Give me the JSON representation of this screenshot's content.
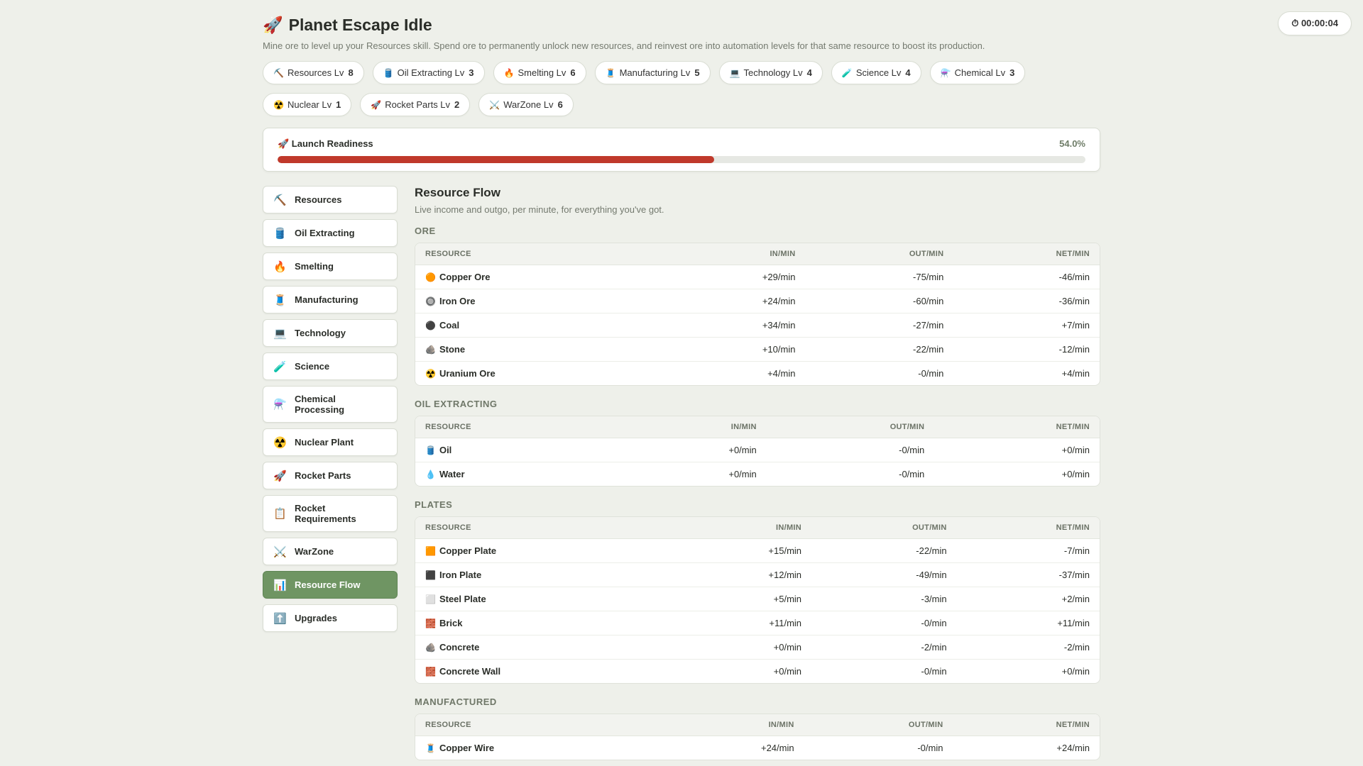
{
  "app": {
    "title": "Planet Escape Idle",
    "title_icon": "🚀",
    "subtitle": "Mine ore to level up your Resources skill. Spend ore to permanently unlock new resources, and reinvest ore into automation levels for that same resource to boost its production.",
    "timer": "⏱ 00:00:04"
  },
  "skills": [
    {
      "icon": "⛏️",
      "label": "Resources Lv",
      "level": "8"
    },
    {
      "icon": "🛢️",
      "label": "Oil Extracting Lv",
      "level": "3"
    },
    {
      "icon": "🔥",
      "label": "Smelting Lv",
      "level": "6"
    },
    {
      "icon": "🧵",
      "label": "Manufacturing Lv",
      "level": "5"
    },
    {
      "icon": "💻",
      "label": "Technology Lv",
      "level": "4"
    },
    {
      "icon": "🧪",
      "label": "Science Lv",
      "level": "4"
    },
    {
      "icon": "⚗️",
      "label": "Chemical Lv",
      "level": "3"
    },
    {
      "icon": "☢️",
      "label": "Nuclear Lv",
      "level": "1"
    },
    {
      "icon": "🚀",
      "label": "Rocket Parts Lv",
      "level": "2"
    },
    {
      "icon": "⚔️",
      "label": "WarZone Lv",
      "level": "6"
    }
  ],
  "readiness": {
    "label": "🚀 Launch Readiness",
    "percent_text": "54.0%",
    "fraction": 0.54,
    "bar_color": "#c0392b"
  },
  "nav": [
    {
      "icon": "⛏️",
      "label": "Resources",
      "active": false
    },
    {
      "icon": "🛢️",
      "label": "Oil Extracting",
      "active": false
    },
    {
      "icon": "🔥",
      "label": "Smelting",
      "active": false
    },
    {
      "icon": "🧵",
      "label": "Manufacturing",
      "active": false
    },
    {
      "icon": "💻",
      "label": "Technology",
      "active": false
    },
    {
      "icon": "🧪",
      "label": "Science",
      "active": false
    },
    {
      "icon": "⚗️",
      "label": "Chemical Processing",
      "active": false
    },
    {
      "icon": "☢️",
      "label": "Nuclear Plant",
      "active": false
    },
    {
      "icon": "🚀",
      "label": "Rocket Parts",
      "active": false
    },
    {
      "icon": "📋",
      "label": "Rocket Requirements",
      "active": false
    },
    {
      "icon": "⚔️",
      "label": "WarZone",
      "active": false
    },
    {
      "icon": "📊",
      "label": "Resource Flow",
      "active": true
    },
    {
      "icon": "⬆️",
      "label": "Upgrades",
      "active": false
    }
  ],
  "main": {
    "title": "Resource Flow",
    "description": "Live income and outgo, per minute, for everything you've got.",
    "columns": [
      "RESOURCE",
      "IN/MIN",
      "OUT/MIN",
      "NET/MIN"
    ],
    "sections": [
      {
        "name": "ORE",
        "rows": [
          {
            "icon": "🟠",
            "name": "Copper Ore",
            "in": "+29/min",
            "out": "-75/min",
            "net": "-46/min",
            "sign": "neg"
          },
          {
            "icon": "🔘",
            "name": "Iron Ore",
            "in": "+24/min",
            "out": "-60/min",
            "net": "-36/min",
            "sign": "neg"
          },
          {
            "icon": "⚫",
            "name": "Coal",
            "in": "+34/min",
            "out": "-27/min",
            "net": "+7/min",
            "sign": "pos"
          },
          {
            "icon": "🪨",
            "name": "Stone",
            "in": "+10/min",
            "out": "-22/min",
            "net": "-12/min",
            "sign": "neg"
          },
          {
            "icon": "☢️",
            "name": "Uranium Ore",
            "in": "+4/min",
            "out": "-0/min",
            "net": "+4/min",
            "sign": "pos"
          }
        ]
      },
      {
        "name": "OIL EXTRACTING",
        "rows": [
          {
            "icon": "🛢️",
            "name": "Oil",
            "in": "+0/min",
            "out": "-0/min",
            "net": "+0/min",
            "sign": "zero"
          },
          {
            "icon": "💧",
            "name": "Water",
            "in": "+0/min",
            "out": "-0/min",
            "net": "+0/min",
            "sign": "zero"
          }
        ]
      },
      {
        "name": "PLATES",
        "rows": [
          {
            "icon": "🟧",
            "name": "Copper Plate",
            "in": "+15/min",
            "out": "-22/min",
            "net": "-7/min",
            "sign": "neg"
          },
          {
            "icon": "⬛",
            "name": "Iron Plate",
            "in": "+12/min",
            "out": "-49/min",
            "net": "-37/min",
            "sign": "neg"
          },
          {
            "icon": "⬜",
            "name": "Steel Plate",
            "in": "+5/min",
            "out": "-3/min",
            "net": "+2/min",
            "sign": "pos"
          },
          {
            "icon": "🧱",
            "name": "Brick",
            "in": "+11/min",
            "out": "-0/min",
            "net": "+11/min",
            "sign": "pos"
          },
          {
            "icon": "🪨",
            "name": "Concrete",
            "in": "+0/min",
            "out": "-2/min",
            "net": "-2/min",
            "sign": "neg"
          },
          {
            "icon": "🧱",
            "name": "Concrete Wall",
            "in": "+0/min",
            "out": "-0/min",
            "net": "+0/min",
            "sign": "zero"
          }
        ]
      },
      {
        "name": "MANUFACTURED",
        "rows": [
          {
            "icon": "🧵",
            "name": "Copper Wire",
            "in": "+24/min",
            "out": "-0/min",
            "net": "+24/min",
            "sign": "pos"
          }
        ]
      }
    ]
  }
}
